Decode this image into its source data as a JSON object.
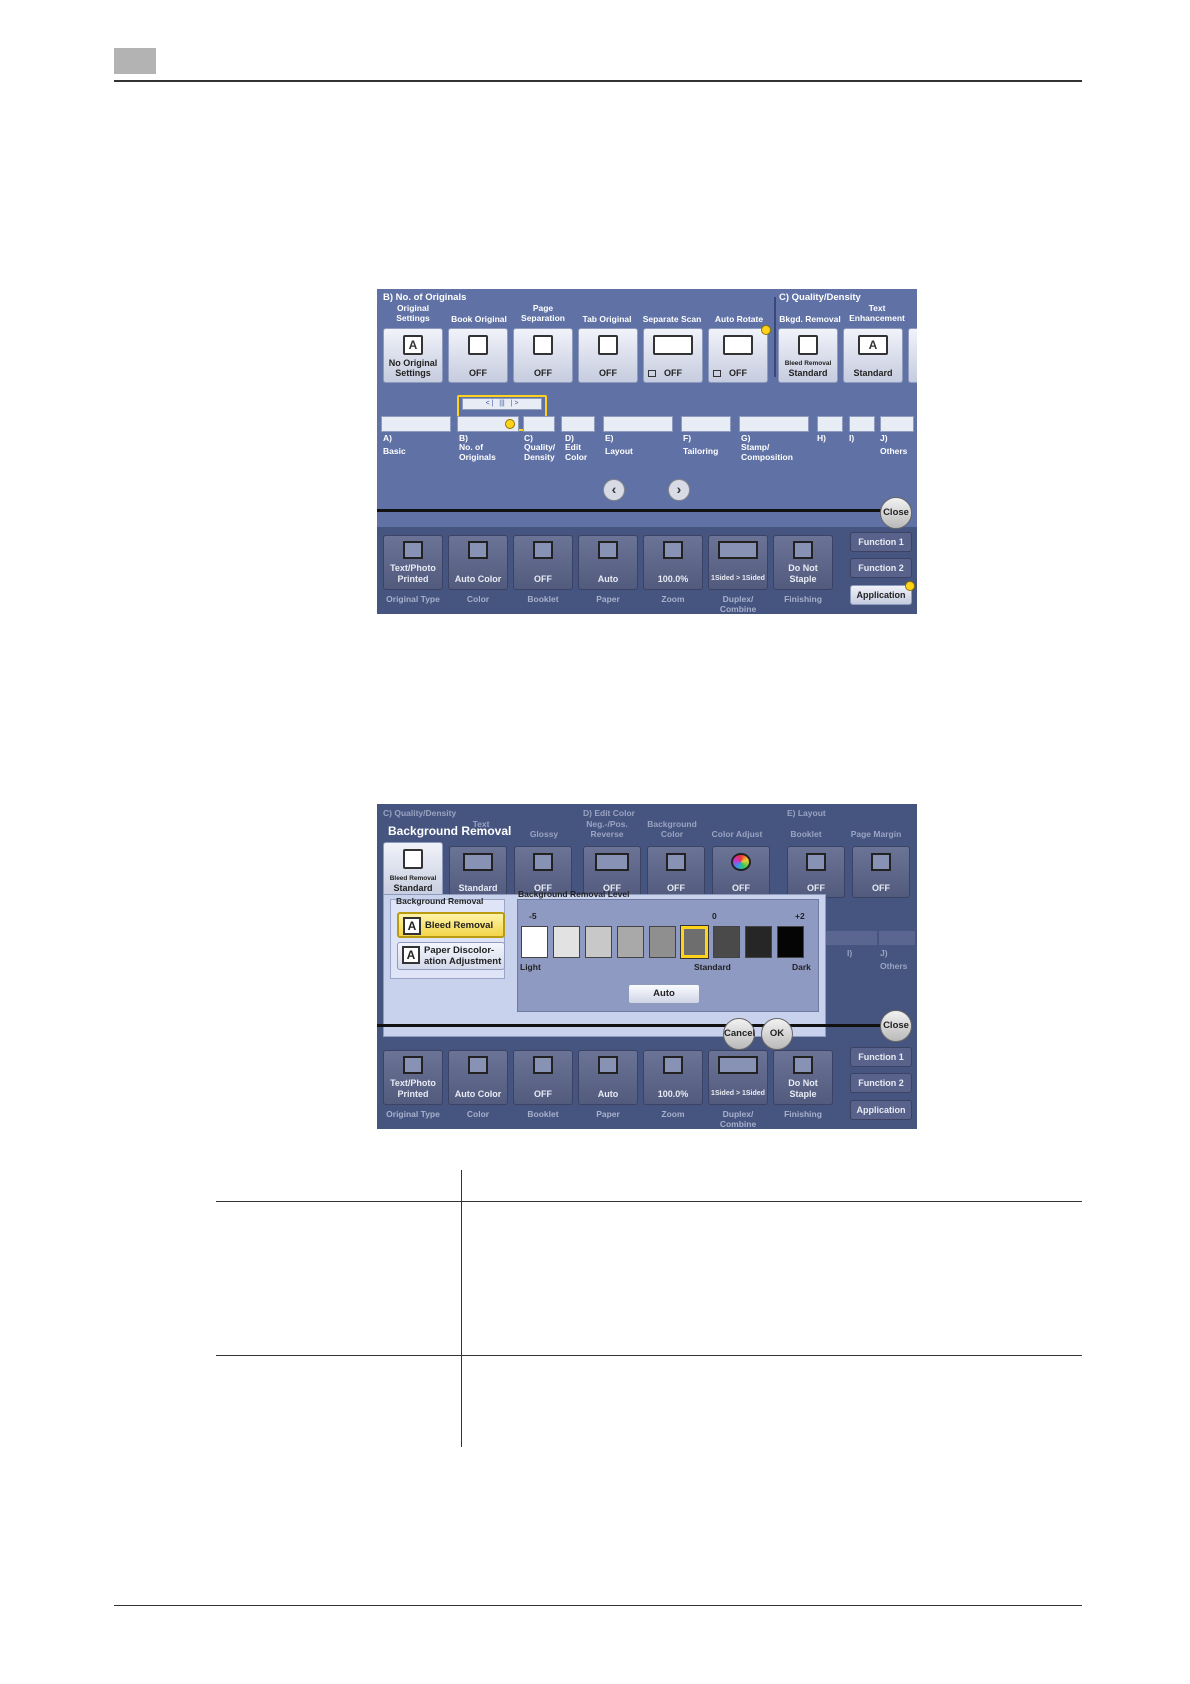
{
  "panel1": {
    "section_b": "B)   No. of Originals",
    "section_c": "C)   Quality/Density",
    "top_buttons": [
      {
        "caption": "Original Settings",
        "label": "No Original Settings",
        "icon": "document-a-icon"
      },
      {
        "caption": "Book Original",
        "label": "OFF",
        "icon": "book-icon"
      },
      {
        "caption": "Page Separation",
        "label": "OFF",
        "icon": "page-separation-icon"
      },
      {
        "caption": "Tab Original",
        "label": "OFF",
        "icon": "tab-original-icon"
      },
      {
        "caption": "Separate Scan",
        "label": "OFF",
        "icon": "separate-scan-icon"
      },
      {
        "caption": "Auto Rotate",
        "label": "OFF",
        "icon": "auto-rotate-icon"
      },
      {
        "caption": "Bkgd. Removal",
        "label": "Standard",
        "sub": "Bleed Removal",
        "icon": "background-removal-icon"
      },
      {
        "caption": "Text Enhancement",
        "label": "Standard",
        "icon": "text-enhancement-icon"
      }
    ],
    "tabs": [
      {
        "letter": "A)",
        "name": "Basic"
      },
      {
        "letter": "B)",
        "name": "No. of Originals"
      },
      {
        "letter": "C)",
        "name": "Quality/ Density"
      },
      {
        "letter": "D)",
        "name": "Edit Color"
      },
      {
        "letter": "E)",
        "name": "Layout"
      },
      {
        "letter": "F)",
        "name": "Tailoring"
      },
      {
        "letter": "G)",
        "name": "Stamp/ Composition"
      },
      {
        "letter": "H)",
        "name": ""
      },
      {
        "letter": "I)",
        "name": ""
      },
      {
        "letter": "J)",
        "name": "Others"
      }
    ],
    "close": "Close"
  },
  "panel2": {
    "title": "Background Removal",
    "section_c": "C)   Quality/Density",
    "section_d": "D)   Edit Color",
    "section_e": "E)   Layout",
    "captions": [
      "Text",
      "Glossy",
      "Neg.-/Pos. Reverse",
      "Background Color",
      "Color Adjust",
      "Booklet",
      "Page Margin"
    ],
    "buttons": [
      {
        "label": "Standard",
        "sub": "Bleed Removal",
        "icon": "background-removal-icon"
      },
      {
        "label": "Standard",
        "icon": "text-enhancement-icon"
      },
      {
        "label": "OFF",
        "icon": "glossy-icon"
      },
      {
        "label": "OFF",
        "icon": "negative-positive-icon"
      },
      {
        "label": "OFF",
        "icon": "background-color-icon"
      },
      {
        "label": "OFF",
        "icon": "color-adjust-icon"
      },
      {
        "label": "OFF",
        "icon": "booklet-icon"
      },
      {
        "label": "OFF",
        "icon": "page-margin-icon"
      }
    ],
    "dialog": {
      "section_label": "Background Removal",
      "options": [
        "Bleed Removal",
        "Paper Discolor- ation Adjustment"
      ],
      "level_label": "Background Removal Level",
      "scale_min": "-5",
      "scale_mid": "0",
      "scale_max": "+2",
      "level_value": 0,
      "swatches": [
        "#ffffff",
        "#e2e2e2",
        "#c8c8c8",
        "#a9a9a9",
        "#8f8f8f",
        "#6e6e6e",
        "#4a4a4a",
        "#262626",
        "#050505"
      ],
      "light": "Light",
      "standard": "Standard",
      "dark": "Dark",
      "auto": "Auto",
      "cancel": "Cancel",
      "ok": "OK"
    },
    "right_tabs": [
      {
        "letter": "I)",
        "name": ""
      },
      {
        "letter": "J)",
        "name": "Others"
      }
    ],
    "close": "Close"
  },
  "bottom_bar": {
    "buttons": [
      {
        "label": "Text/Photo Printed",
        "caption": "Original Type",
        "icon": "original-type-icon"
      },
      {
        "label": "Auto Color",
        "caption": "Color",
        "icon": "color-icon"
      },
      {
        "label": "OFF",
        "caption": "Booklet",
        "icon": "booklet-icon"
      },
      {
        "label": "Auto",
        "caption": "Paper",
        "icon": "paper-icon"
      },
      {
        "label": "100.0%",
        "caption": "Zoom",
        "icon": "zoom-icon"
      },
      {
        "label": "1Sided > 1Sided",
        "caption": "Duplex/ Combine",
        "icon": "duplex-icon"
      },
      {
        "label": "Do Not Staple",
        "caption": "Finishing",
        "icon": "finishing-icon"
      }
    ],
    "functions": [
      "Function 1",
      "Function 2",
      "Application"
    ]
  },
  "colors": {
    "panel_blue": "#5f71a5",
    "panel_dark": "#46557f",
    "highlight": "#ffd21c"
  }
}
